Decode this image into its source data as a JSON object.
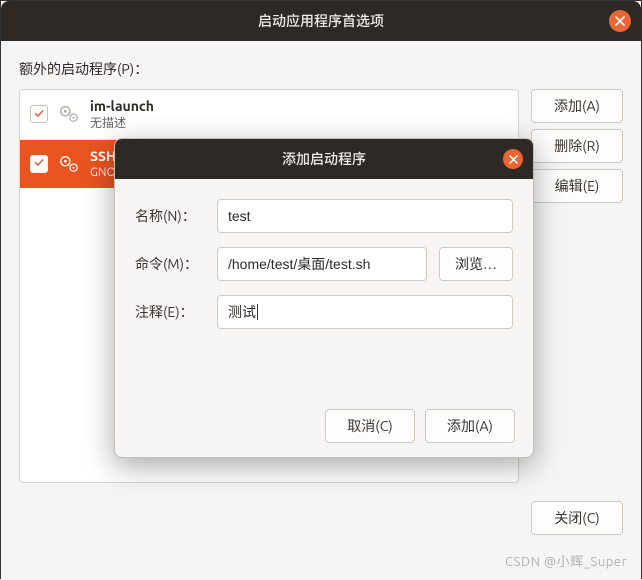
{
  "main": {
    "title": "启动应用程序首选项",
    "section_label": "额外的启动程序(P)：",
    "items": [
      {
        "checked": true,
        "name": "im-launch",
        "desc": "无描述",
        "selected": false
      },
      {
        "checked": true,
        "name": "SSH ",
        "desc": "GNO",
        "selected": true
      }
    ],
    "buttons": {
      "add": "添加(A)",
      "remove": "删除(R)",
      "edit": "编辑(E)",
      "close": "关闭(C)"
    }
  },
  "modal": {
    "title": "添加启动程序",
    "labels": {
      "name": "名称(N)：",
      "command": "命令(M)：",
      "comment": "注释(E)："
    },
    "values": {
      "name": "test",
      "command": "/home/test/桌面/test.sh",
      "comment": "测试"
    },
    "buttons": {
      "browse": "浏览…",
      "cancel": "取消(C)",
      "add": "添加(A)"
    }
  },
  "watermark": "CSDN @小辉_Super"
}
